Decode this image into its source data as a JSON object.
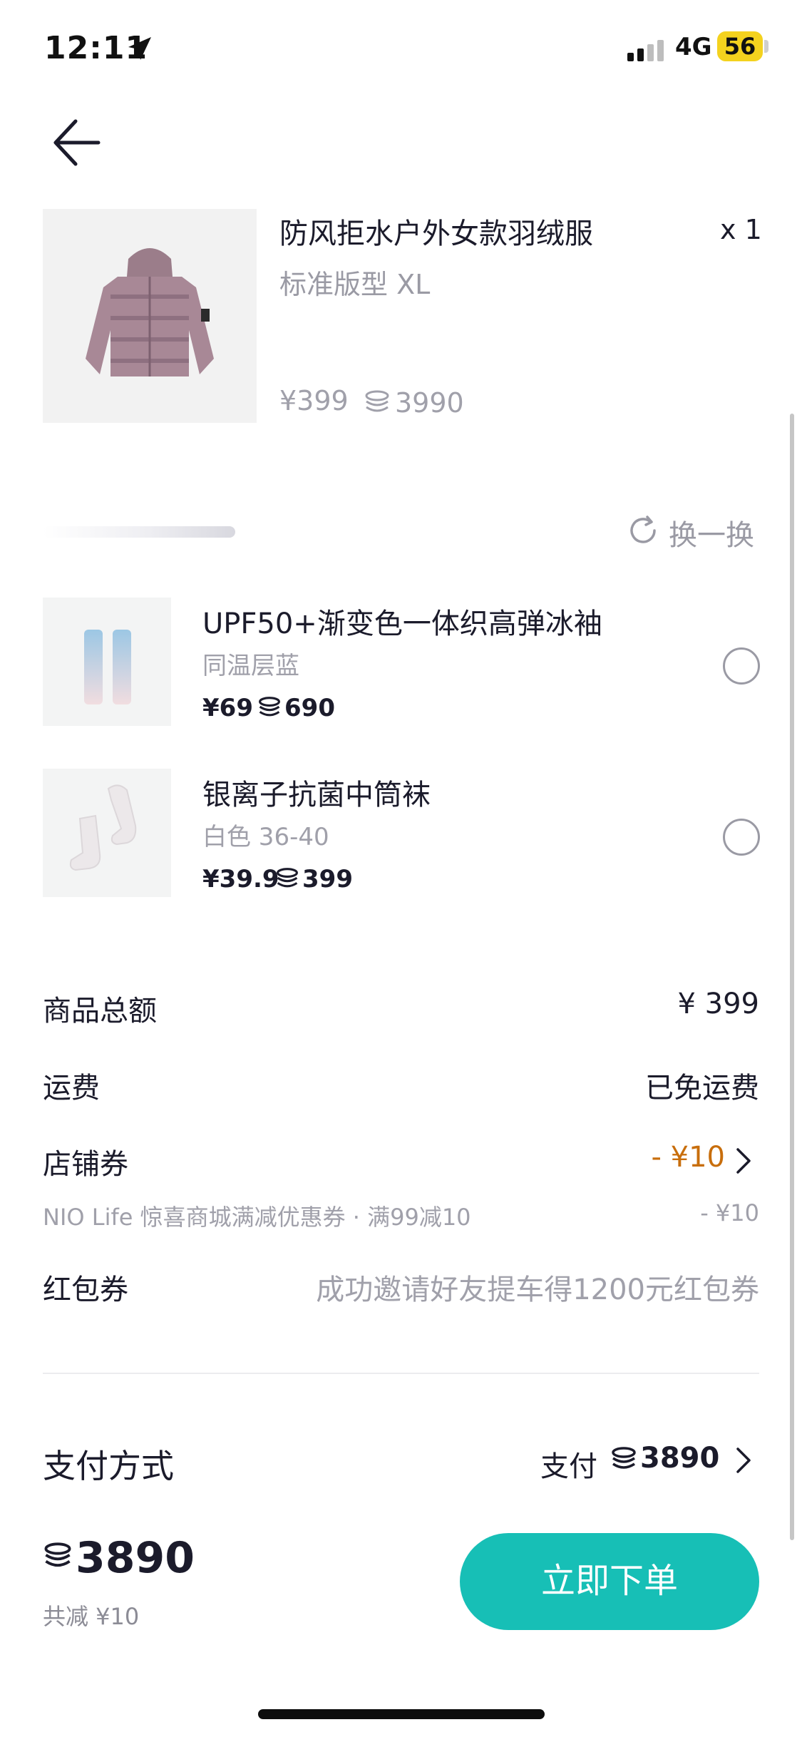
{
  "status_bar": {
    "time": "12:11",
    "network": "4G",
    "battery": "56"
  },
  "product": {
    "title": "防风拒水户外女款羽绒服",
    "quantity": "x 1",
    "variant": "标准版型 XL",
    "price": "¥399",
    "points": "3990"
  },
  "recommend": {
    "refresh_label": "换一换",
    "items": [
      {
        "title": "UPF50+渐变色一体织高弹冰袖",
        "variant": "同温层蓝",
        "price": "¥69",
        "points": "690"
      },
      {
        "title": "银离子抗菌中筒袜",
        "variant": "白色 36-40",
        "price": "¥39.9",
        "points": "399"
      }
    ]
  },
  "summary": {
    "subtotal_label": "商品总额",
    "subtotal_value": "¥ 399",
    "shipping_label": "运费",
    "shipping_value": "已免运费",
    "store_coupon_label": "店铺券",
    "store_coupon_value": "- ¥10",
    "store_coupon_detail": "NIO Life 惊喜商城满减优惠券 · 满99减10",
    "store_coupon_detail_value": "- ¥10",
    "red_packet_label": "红包券",
    "red_packet_hint": "成功邀请好友提车得1200元红包券"
  },
  "payment": {
    "label": "支付方式",
    "value_prefix": "支付",
    "amount": "3890"
  },
  "footer": {
    "total": "3890",
    "saving": "共减 ¥10",
    "submit_label": "立即下单"
  },
  "colors": {
    "accent": "#17bfb6",
    "discount": "#c86e0c",
    "battery": "#f4d21e"
  }
}
